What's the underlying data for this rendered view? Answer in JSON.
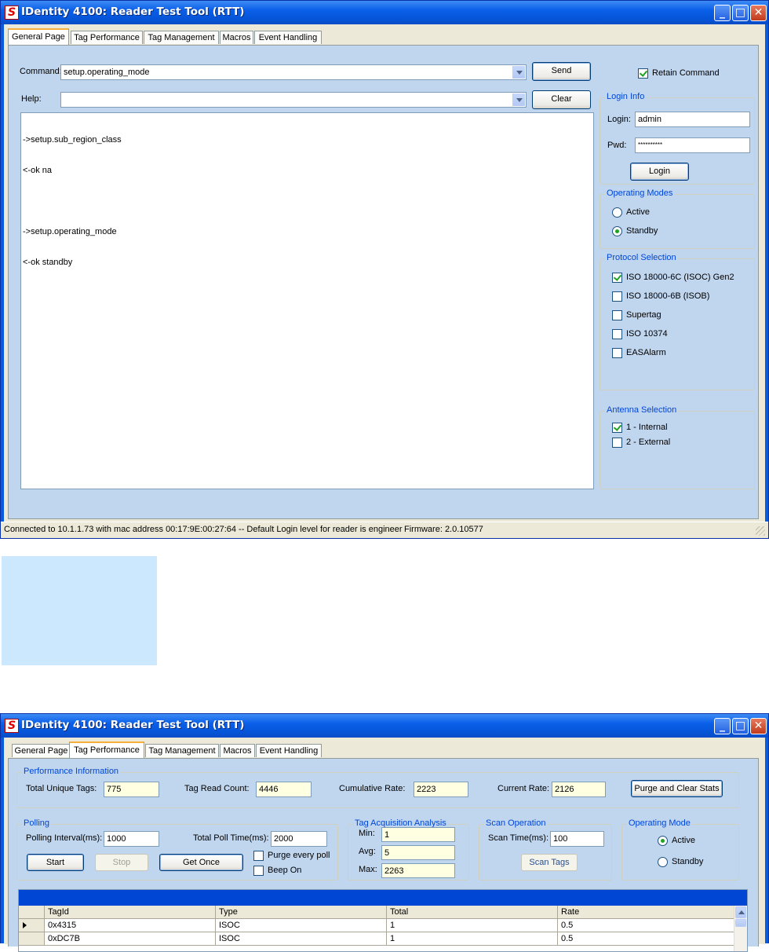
{
  "window1": {
    "title": "IDentity 4100: Reader Test Tool (RTT)",
    "app_icon": "S",
    "tabs": [
      "General Page",
      "Tag Performance",
      "Tag Management",
      "Macros",
      "Event Handling"
    ],
    "active_tab": "General Page",
    "command_label": "Command:",
    "command_value": "setup.operating_mode",
    "send_label": "Send",
    "help_label": "Help:",
    "help_value": "",
    "clear_label": "Clear",
    "retain_command_label": "Retain Command",
    "retain_command_checked": true,
    "log_lines": [
      "->setup.sub_region_class",
      "<-ok na",
      "",
      "->setup.operating_mode",
      "<-ok standby"
    ],
    "login_info": {
      "title": "Login Info",
      "login_label": "Login:",
      "login_value": "admin",
      "pwd_label": "Pwd:",
      "pwd_value": "**********",
      "login_button": "Login"
    },
    "operating_modes": {
      "title": "Operating Modes",
      "options": [
        {
          "label": "Active",
          "selected": false
        },
        {
          "label": "Standby",
          "selected": true
        }
      ]
    },
    "protocol_selection": {
      "title": "Protocol Selection",
      "options": [
        {
          "label": "ISO 18000-6C (ISOC) Gen2",
          "checked": true
        },
        {
          "label": "ISO 18000-6B (ISOB)",
          "checked": false
        },
        {
          "label": "Supertag",
          "checked": false
        },
        {
          "label": "ISO 10374",
          "checked": false
        },
        {
          "label": "EASAlarm",
          "checked": false
        }
      ]
    },
    "antenna_selection": {
      "title": "Antenna Selection",
      "options": [
        {
          "label": "1 - Internal",
          "checked": true
        },
        {
          "label": "2 - External",
          "checked": false
        }
      ]
    },
    "status_text": "Connected to 10.1.1.73 with mac address 00:17:9E:00:27:64 -- Default Login level for reader is engineer",
    "firmware_text": "Firmware: 2.0.10577"
  },
  "window2": {
    "title": "IDentity 4100: Reader Test Tool (RTT)",
    "app_icon": "S",
    "tabs": [
      "General Page",
      "Tag Performance",
      "Tag Management",
      "Macros",
      "Event Handling"
    ],
    "active_tab": "Tag Performance",
    "performance_info": {
      "title": "Performance Information",
      "total_unique_tags_label": "Total Unique Tags:",
      "total_unique_tags": "775",
      "tag_read_count_label": "Tag Read Count:",
      "tag_read_count": "4446",
      "cumulative_rate_label": "Cumulative Rate:",
      "cumulative_rate": "2223",
      "current_rate_label": "Current Rate:",
      "current_rate": "2126",
      "purge_button": "Purge and Clear Stats"
    },
    "polling": {
      "title": "Polling",
      "interval_label": "Polling Interval(ms):",
      "interval_value": "1000",
      "total_poll_label": "Total Poll Time(ms):",
      "total_poll_value": "2000",
      "start_button": "Start",
      "stop_button": "Stop",
      "get_once_button": "Get Once",
      "purge_every_poll_label": "Purge every poll",
      "beep_on_label": "Beep On"
    },
    "acquisition": {
      "title": "Tag Acquisition Analysis",
      "min_label": "Min:",
      "min_value": "1",
      "avg_label": "Avg:",
      "avg_value": "5",
      "max_label": "Max:",
      "max_value": "2263"
    },
    "scan": {
      "title": "Scan Operation",
      "scan_time_label": "Scan Time(ms):",
      "scan_time_value": "100",
      "scan_button": "Scan Tags"
    },
    "operating_mode": {
      "title": "Operating Mode",
      "options": [
        {
          "label": "Active",
          "selected": true
        },
        {
          "label": "Standby",
          "selected": false
        }
      ]
    },
    "table": {
      "columns": [
        "TagId",
        "Type",
        "Total",
        "Rate"
      ],
      "rows": [
        {
          "TagId": "0x4315",
          "Type": "ISOC",
          "Total": "1",
          "Rate": "0.5"
        },
        {
          "TagId": "0xDC7B",
          "Type": "ISOC",
          "Total": "1",
          "Rate": "0.5"
        }
      ]
    }
  },
  "colors": {
    "titlebar": "#0a5fe8",
    "panel": "#c0d5ee",
    "group_title": "#0046d5",
    "highlight_box": "#cce8ff",
    "yellow_field": "#ffffe1"
  }
}
